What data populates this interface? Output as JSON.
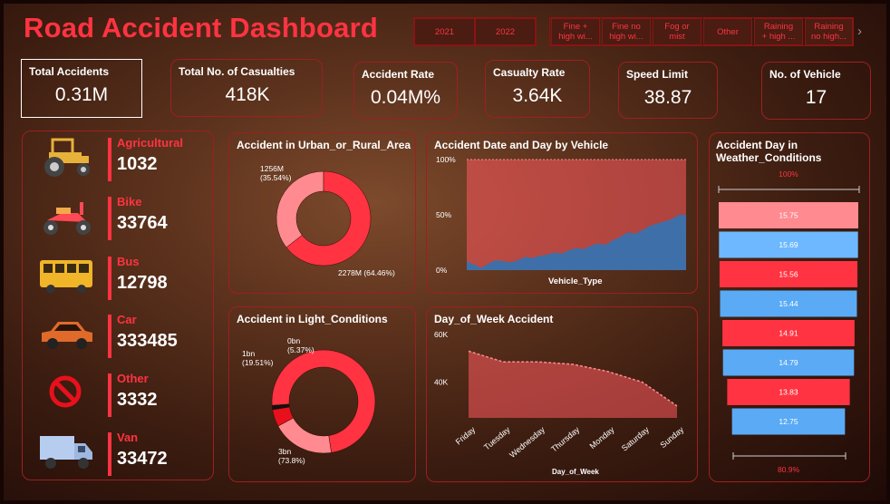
{
  "header": {
    "title": "Road Accident Dashboard"
  },
  "years": [
    "2021",
    "2022"
  ],
  "weather_slicers": [
    [
      "Fine +",
      "high wi..."
    ],
    [
      "Fine no",
      "high wi..."
    ],
    [
      "Fog or",
      "mist"
    ],
    [
      "Other"
    ],
    [
      "Raining",
      "+ high ..."
    ],
    [
      "Raining",
      "no high..."
    ]
  ],
  "kpis": [
    {
      "label": "Total Accidents",
      "value": "0.31M"
    },
    {
      "label": "Total No. of Casualties",
      "value": "418K"
    },
    {
      "label": "Accident Rate",
      "value": "0.04M%"
    },
    {
      "label": "Casualty Rate",
      "value": "3.64K"
    },
    {
      "label": "Speed Limit",
      "value": "38.87"
    },
    {
      "label": "No. of Vehicle",
      "value": "17"
    }
  ],
  "vehicles": [
    {
      "name": "Agricultural",
      "value": "1032",
      "icon": "tractor-icon"
    },
    {
      "name": "Bike",
      "value": "33764",
      "icon": "motorbike-icon"
    },
    {
      "name": "Bus",
      "value": "12798",
      "icon": "bus-icon"
    },
    {
      "name": "Car",
      "value": "333485",
      "icon": "car-icon"
    },
    {
      "name": "Other",
      "value": "3332",
      "icon": "no-entry-icon"
    },
    {
      "name": "Van",
      "value": "33472",
      "icon": "van-icon"
    }
  ],
  "colors": {
    "accent": "#ff3341",
    "light_red": "#ff8a8f",
    "blue": "#5aaaf5",
    "area_blue": "#3f6fa8",
    "dark_border": "#9c2020"
  },
  "chart_data": [
    {
      "type": "pie",
      "title": "Accident in Urban_or_Rural_Area",
      "labels": [
        "1256M\n(35.54%)",
        "2278M (64.46%)"
      ],
      "values": [
        35.54,
        64.46
      ],
      "colors": [
        "#ff8a8f",
        "#ff3341"
      ]
    },
    {
      "type": "pie",
      "title": "Accident in Light_Conditions",
      "labels": [
        "3bn\n(73.8%)",
        "1bn\n(19.51%)",
        "0bn\n(5.37%)",
        ""
      ],
      "values": [
        73.8,
        19.51,
        5.37,
        1.32
      ],
      "colors": [
        "#ff3341",
        "#ff8a8f",
        "#e8101c",
        "#111111"
      ]
    },
    {
      "type": "area",
      "title": "Accident Date and Day by Vehicle",
      "xlabel": "Vehicle_Type",
      "ylabel": "",
      "yticks": [
        "0%",
        "50%",
        "100%"
      ],
      "ylim": [
        0,
        100
      ],
      "x": [
        0,
        1,
        2,
        3,
        4,
        5,
        6,
        7,
        8,
        9,
        10,
        11,
        12,
        13,
        14,
        15,
        16,
        17,
        18,
        19,
        20,
        21,
        22,
        23,
        24,
        25,
        26,
        27,
        28,
        29,
        30
      ],
      "series": [
        {
          "values": [
            8,
            5,
            2,
            6,
            9,
            8,
            7,
            9,
            12,
            11,
            13,
            14,
            16,
            15,
            18,
            20,
            19,
            22,
            24,
            23,
            27,
            30,
            34,
            33,
            36,
            40,
            42,
            44,
            46,
            50,
            50
          ]
        }
      ]
    },
    {
      "type": "area",
      "title": "Day_of_Week Accident",
      "xlabel": "Day_of_Week",
      "yticks": [
        "40K",
        "60K"
      ],
      "ylim": [
        25000,
        60000
      ],
      "categories": [
        "Friday",
        "Tuesday",
        "Wednesday",
        "Thursday",
        "Monday",
        "Saturday",
        "Sunday"
      ],
      "values": [
        53000,
        48500,
        48500,
        47500,
        44500,
        40000,
        30000
      ]
    },
    {
      "type": "bar",
      "title": "Accident Day in Weather_Conditions",
      "top_label": "100%",
      "bottom_label": "80.9%",
      "values": [
        15.75,
        15.69,
        15.56,
        15.44,
        14.91,
        14.79,
        13.83,
        12.75
      ],
      "labels": [
        "15.75",
        "15.69",
        "15.56",
        "15.44",
        "14.91",
        "14.79",
        "13.83",
        "12.75"
      ],
      "colors": [
        "#ff8a8f",
        "#6db8ff",
        "#ff3341",
        "#5aaaf5",
        "#ff3341",
        "#5aaaf5",
        "#ff3341",
        "#5aaaf5"
      ]
    }
  ]
}
